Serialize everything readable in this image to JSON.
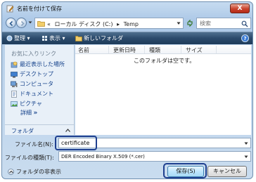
{
  "window": {
    "title": "名前を付けて保存",
    "close_label": "X"
  },
  "address": {
    "crumbs": [
      "«",
      "ローカル ディスク (C:)",
      "▸",
      "Temp"
    ]
  },
  "search": {
    "placeholder": "検索"
  },
  "toolbar": {
    "organize_label": "整理 ▾",
    "views_label": "表示 ▾",
    "new_folder_label": "新しいフォルダ",
    "help_label": "?"
  },
  "navpane": {
    "favorites_heading": "お気に入りリンク",
    "favorites": [
      {
        "label": "最近表示した場所",
        "icon": "recent-places-icon"
      },
      {
        "label": "デスクトップ",
        "icon": "desktop-icon"
      },
      {
        "label": "コンピュータ",
        "icon": "computer-icon"
      },
      {
        "label": "ドキュメント",
        "icon": "documents-icon"
      },
      {
        "label": "ピクチャ",
        "icon": "pictures-icon"
      }
    ],
    "more_label": "詳細",
    "more_chevrons": "»",
    "folders_label": "フォルダ"
  },
  "content": {
    "columns": [
      "名前",
      "更新日時",
      "種類",
      "サイズ"
    ],
    "empty_message": "このフォルダは空です。"
  },
  "form": {
    "filename_label": "ファイル名(N):",
    "filename_value": "certificate",
    "filetype_label": "ファイルの種類(T):",
    "filetype_value": "DER Encoded Binary X.509 (*.cer)",
    "hide_folders_label": "フォルダの非表示",
    "save_label": "保存(S)",
    "cancel_label": "キャンセル"
  },
  "colors": {
    "accent": "#1e3f8f",
    "toolbar": "#2b4a6b",
    "link": "#15428b"
  }
}
